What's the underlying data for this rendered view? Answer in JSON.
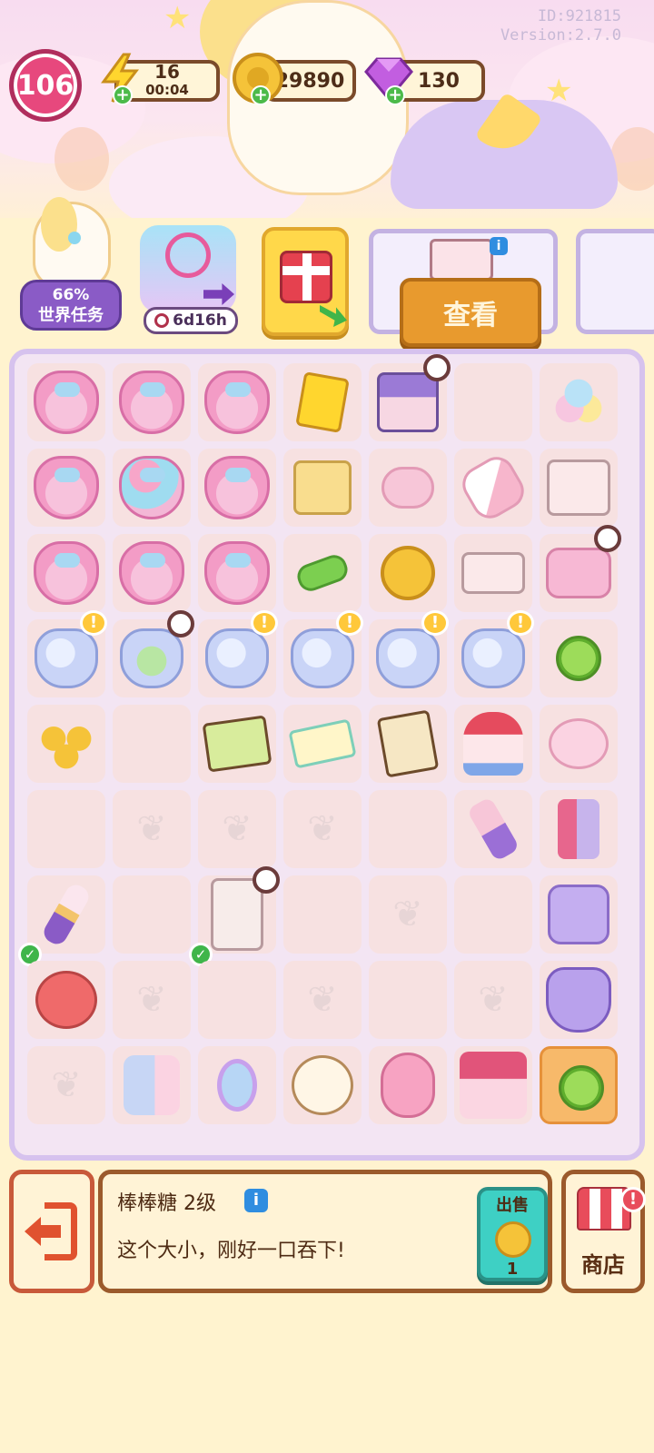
{
  "header": {
    "id_label": "ID:921815",
    "version_label": "Version:2.7.0",
    "level": "106",
    "energy": {
      "value": "16",
      "timer": "00:04",
      "icon": "lightning-icon"
    },
    "coins": {
      "value": "29890",
      "icon": "coin-icon"
    },
    "gems": {
      "value": "130",
      "icon": "gem-icon"
    }
  },
  "world_task": {
    "percent": "66%",
    "label": "世界任务"
  },
  "event": {
    "timer": "6d16h"
  },
  "order": {
    "view_label": "查看"
  },
  "board": {
    "rows": [
      [
        "bag",
        "bag",
        "bag",
        "ticket",
        "house",
        "empty",
        "cotton"
      ],
      [
        "bag",
        "balloons",
        "bag",
        "giftbox",
        "roll",
        "marshmallow",
        "dresser"
      ],
      [
        "bag",
        "bag",
        "bag",
        "candy",
        "coin",
        "drawer",
        "bed"
      ],
      [
        "jar",
        "jar-mint",
        "jar",
        "jar",
        "jar",
        "jar",
        "lollipop"
      ],
      [
        "coins",
        "empty",
        "map",
        "ticket2",
        "book",
        "carousel",
        "compact"
      ],
      [
        "empty",
        "locked",
        "locked",
        "locked",
        "empty",
        "roller",
        "lipstick"
      ],
      [
        "brushes",
        "empty",
        "cabinet",
        "empty",
        "locked",
        "empty",
        "cardigan"
      ],
      [
        "hamster",
        "locked",
        "empty",
        "locked",
        "empty",
        "locked",
        "dress"
      ],
      [
        "locked",
        "lotion",
        "mirror",
        "dog",
        "bunny",
        "castle",
        "lollipop-sel"
      ]
    ]
  },
  "info_panel": {
    "item_name": "棒棒糖 2级",
    "description": "这个大小，刚好一口吞下!",
    "sell_label": "出售",
    "sell_value": "1"
  },
  "shop": {
    "label": "商店"
  },
  "colors": {
    "accent": "#e89a2e",
    "board": "#f3e5f3",
    "selected": "#f7b96a"
  }
}
